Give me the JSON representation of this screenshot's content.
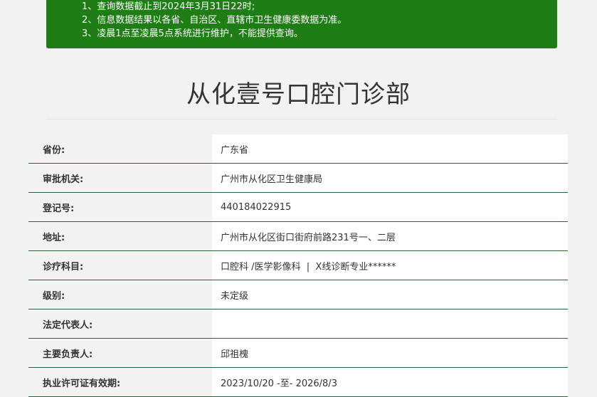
{
  "notice": {
    "lines": [
      "1、查询数据截止到2024年3月31日22时;",
      "2、信息数据结果以各省、自治区、直辖市卫生健康委数据为准。",
      "3、凌晨1点至凌晨5点系统进行维护，不能提供查询。"
    ]
  },
  "page": {
    "title": "从化壹号口腔门诊部"
  },
  "rows": [
    {
      "label": "省份:",
      "value": "广东省"
    },
    {
      "label": "审批机关:",
      "value": "广州市从化区卫生健康局"
    },
    {
      "label": "登记号:",
      "value": "440184022915"
    },
    {
      "label": "地址:",
      "value": "广州市从化区街口街府前路231号一、二层"
    },
    {
      "label": "诊疗科目:",
      "value": "口腔科 /医学影像科  |  X线诊断专业******"
    },
    {
      "label": "级别:",
      "value": "未定级"
    },
    {
      "label": "法定代表人:",
      "value": ""
    },
    {
      "label": "主要负责人:",
      "value": "邱祖槐"
    },
    {
      "label": "执业许可证有效期:",
      "value": "2023/10/20 -至- 2026/8/3"
    }
  ]
}
